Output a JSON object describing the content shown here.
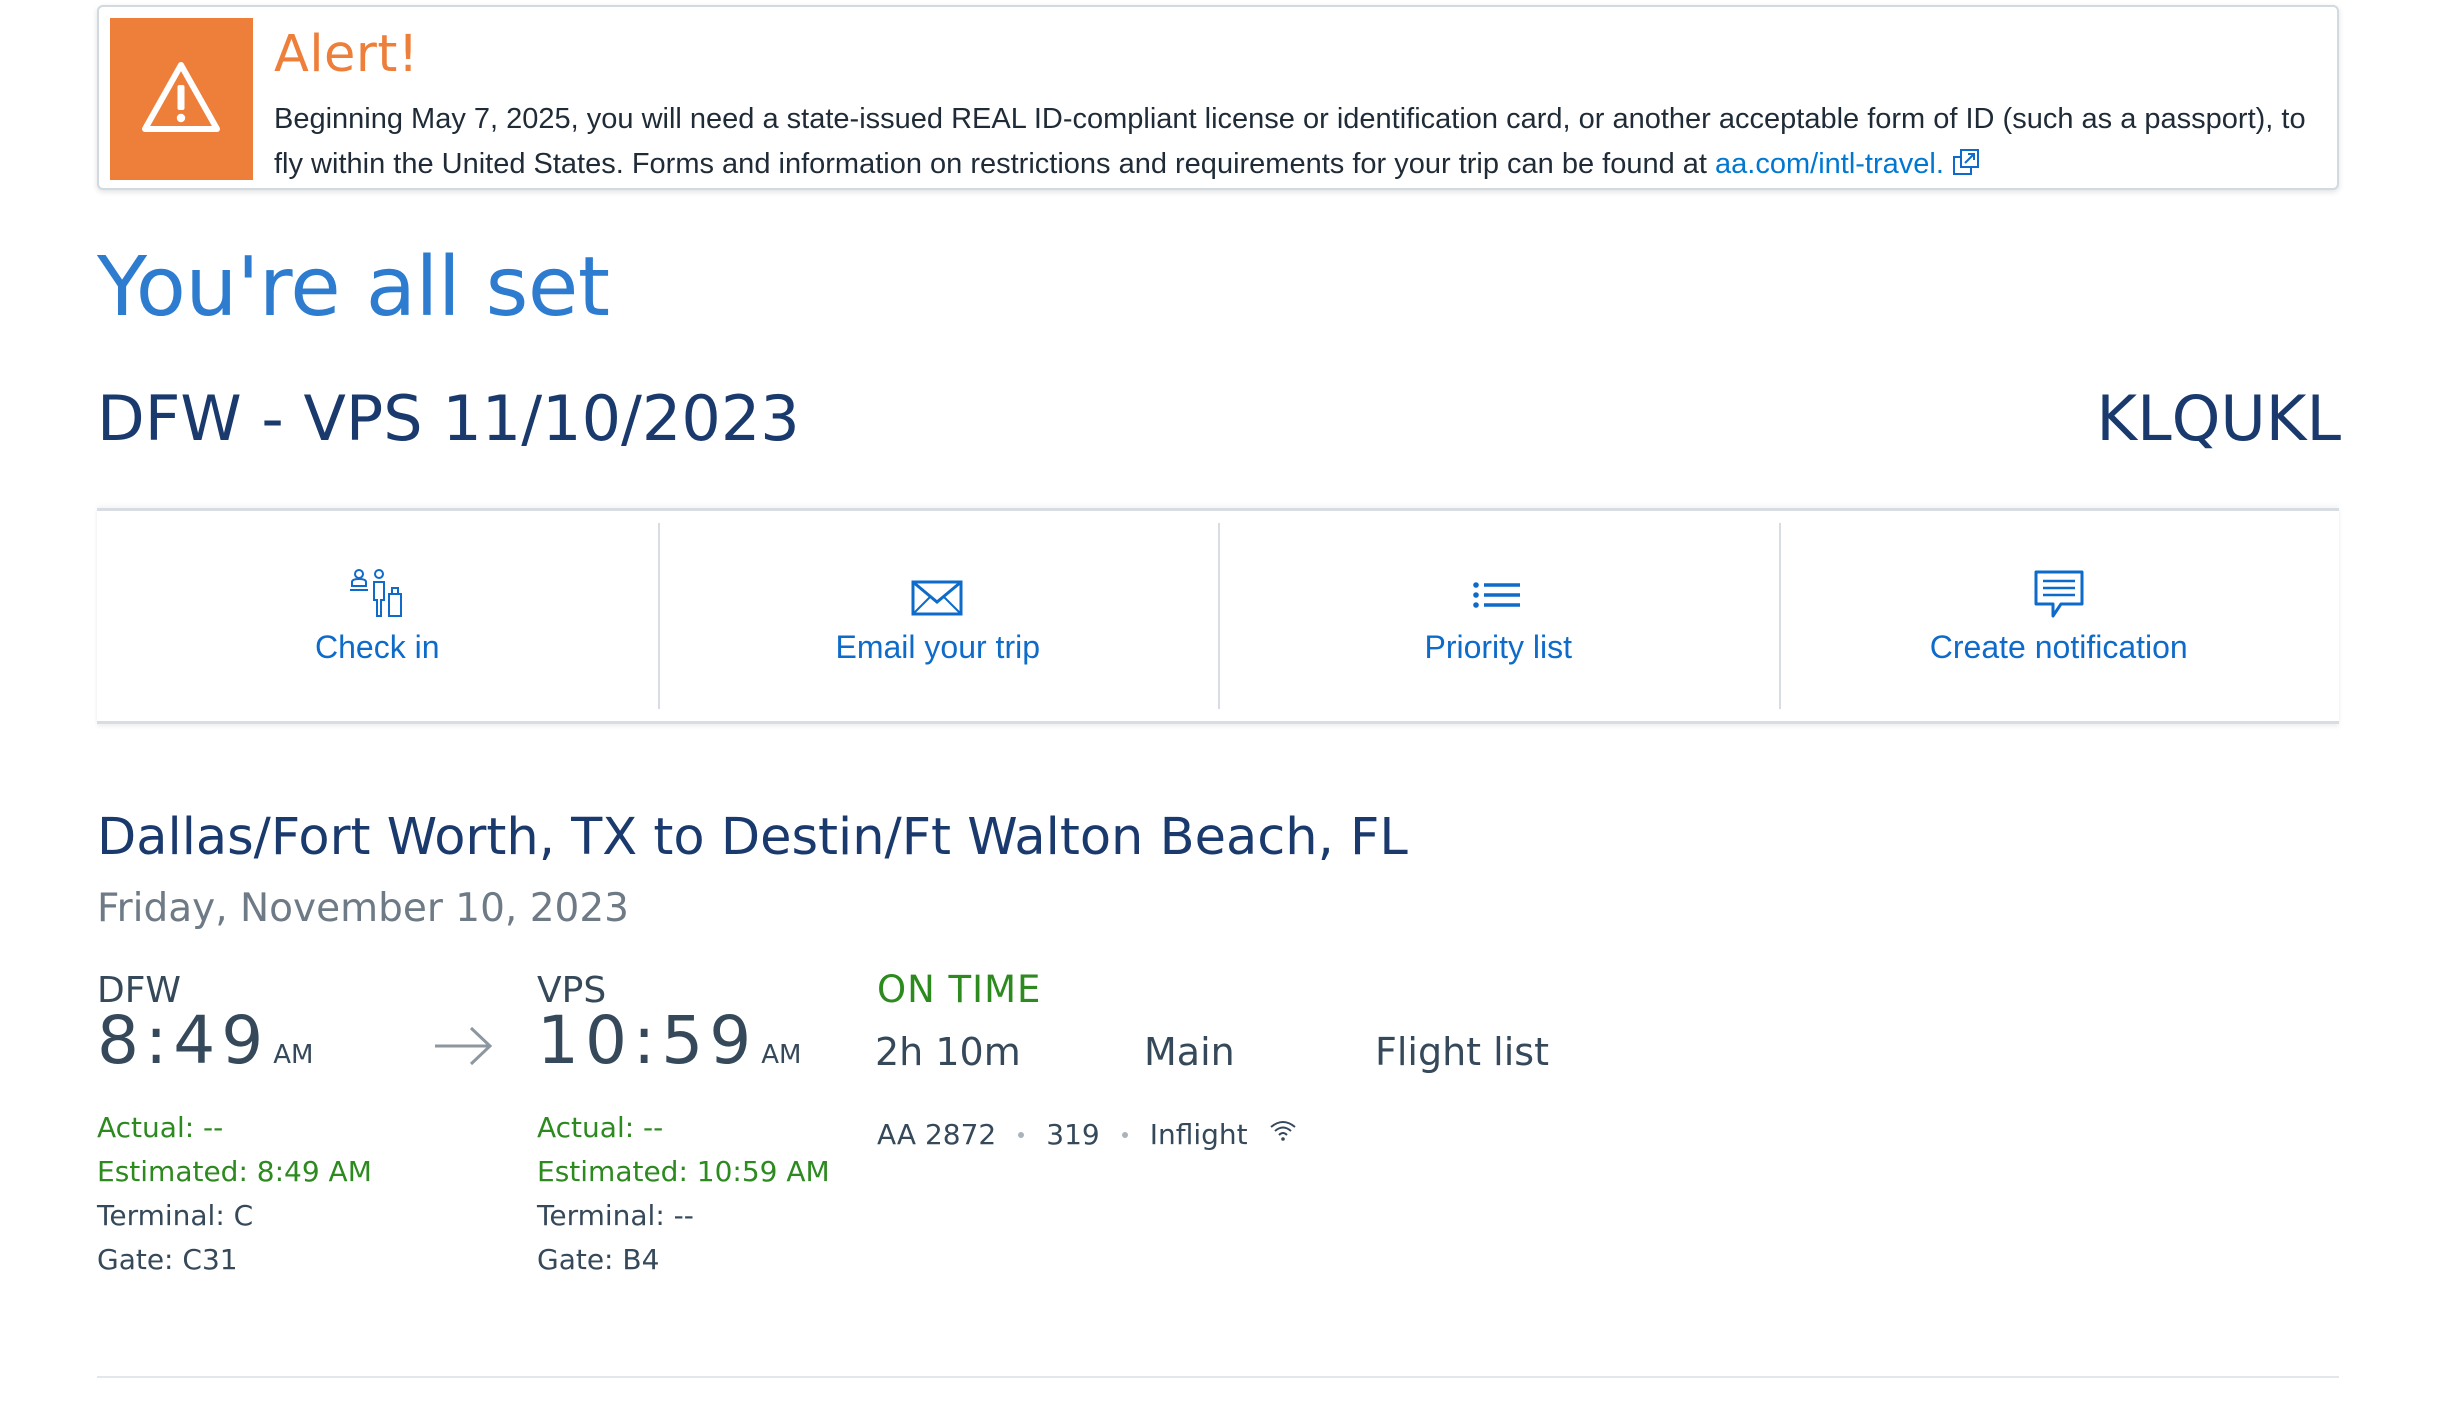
{
  "alert": {
    "title": "Alert!",
    "message": "Beginning May 7, 2025, you will need a state-issued REAL ID-compliant license or identification card, or another acceptable form of ID (such as a passport), to fly within the United States. Forms and information on restrictions and requirements for your trip can be found at ",
    "link_text": "aa.com/intl-travel.",
    "icon": "warning-icon",
    "color": "#ee7f3b"
  },
  "header": {
    "confirmation_title": "You're all set",
    "trip_summary": "DFW - VPS 11/10/2023",
    "record_locator": "KLQUKL"
  },
  "actions": [
    {
      "label": "Check in",
      "icon": "check-in-icon"
    },
    {
      "label": "Email your trip",
      "icon": "envelope-icon"
    },
    {
      "label": "Priority list",
      "icon": "list-icon"
    },
    {
      "label": "Create notification",
      "icon": "notification-icon"
    }
  ],
  "flight": {
    "route_title": "Dallas/Fort Worth, TX to Destin/Ft Walton Beach, FL",
    "date": "Friday, November 10, 2023",
    "departure": {
      "code": "DFW",
      "time": "8:49",
      "ampm": "AM",
      "actual": "Actual: --",
      "estimated": "Estimated: 8:49 AM",
      "terminal": "Terminal: C",
      "gate": "Gate: C31"
    },
    "arrival": {
      "code": "VPS",
      "time": "10:59",
      "ampm": "AM",
      "actual": "Actual: --",
      "estimated": "Estimated: 10:59 AM",
      "terminal": "Terminal: --",
      "gate": "Gate: B4"
    },
    "status": "ON TIME",
    "duration": "2h 10m",
    "cabin": "Main",
    "flight_list_label": "Flight list",
    "flight_number": "AA 2872",
    "aircraft": "319",
    "inflight_label": "Inflight"
  },
  "colors": {
    "link_blue": "#0e6bc9",
    "heading_blue": "#2d7ccf",
    "navy": "#1a3a6e",
    "status_green": "#2c8a1e"
  }
}
